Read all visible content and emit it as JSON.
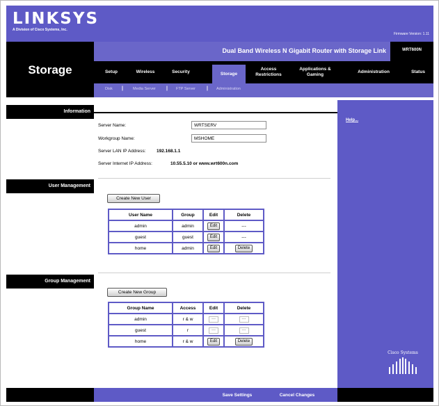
{
  "header": {
    "logo": "LINKSYS",
    "logo_tagline": "A Division of Cisco Systems, Inc.",
    "firmware": "Firmware Version: 1.11",
    "section_title": "Storage",
    "model_name": "Dual Band Wireless N Gigabit Router with Storage Link",
    "model_number": "WRT600N"
  },
  "tabs": [
    {
      "label": "Setup"
    },
    {
      "label": "Wireless"
    },
    {
      "label": "Security"
    },
    {
      "label": "Storage",
      "active": true
    },
    {
      "label": "Access Restrictions"
    },
    {
      "label": "Applications & Gaming"
    },
    {
      "label": "Administration"
    },
    {
      "label": "Status"
    }
  ],
  "subtabs": [
    {
      "label": "Disk"
    },
    {
      "label": "Media Server"
    },
    {
      "label": "FTP Server"
    },
    {
      "label": "Administration"
    }
  ],
  "sections": {
    "information": "Information",
    "user_management": "User Management",
    "group_management": "Group Management"
  },
  "information": {
    "server_name_label": "Server Name:",
    "server_name_value": "WRTSERV",
    "workgroup_label": "Workgroup Name:",
    "workgroup_value": "MSHOME",
    "lan_ip_label": "Server LAN IP Address:",
    "lan_ip_value": "192.168.1.1",
    "internet_ip_label": "Server Internet IP Address:",
    "internet_ip_value": "10.55.5.10 or www.wrt600n.com"
  },
  "users": {
    "create_button": "Create New User",
    "headers": [
      "User Name",
      "Group",
      "Edit",
      "Delete"
    ],
    "rows": [
      {
        "name": "admin",
        "group": "admin",
        "edit": "Edit",
        "delete": "---"
      },
      {
        "name": "guest",
        "group": "guest",
        "edit": "Edit",
        "delete": "---"
      },
      {
        "name": "home",
        "group": "admin",
        "edit": "Edit",
        "delete": "Delete"
      }
    ]
  },
  "groups": {
    "create_button": "Create New Group",
    "headers": [
      "Group Name",
      "Access",
      "Edit",
      "Delete"
    ],
    "rows": [
      {
        "name": "admin",
        "access": "r & w",
        "edit": "---",
        "delete": "---"
      },
      {
        "name": "guest",
        "access": "r",
        "edit": "---",
        "delete": "---"
      },
      {
        "name": "home",
        "access": "r & w",
        "edit": "Edit",
        "delete": "Delete"
      }
    ]
  },
  "help_link": "Help...",
  "cisco_logo_text": "Cisco Systems",
  "footer": {
    "save": "Save Settings",
    "cancel": "Cancel Changes"
  },
  "colors": {
    "brand_purple": "#5e5ac6",
    "nav_purple": "#6a66c9",
    "black": "#000000"
  }
}
